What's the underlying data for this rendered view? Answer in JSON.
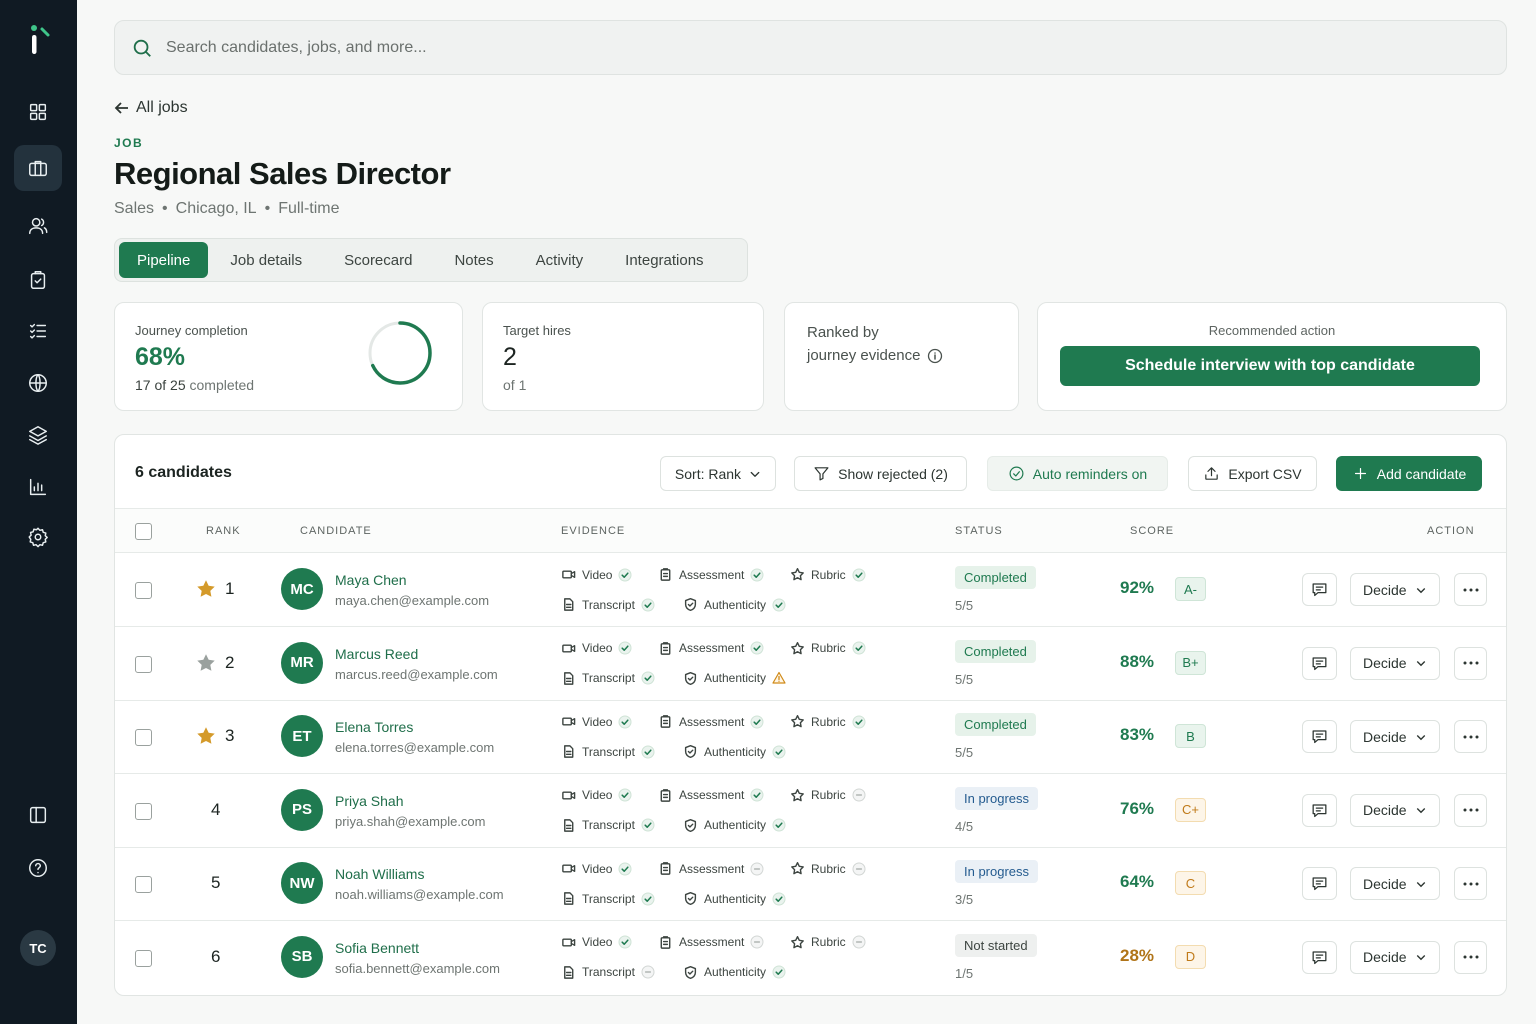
{
  "user": {
    "initials": "TC"
  },
  "search": {
    "placeholder": "Search candidates, jobs, and more..."
  },
  "nav": {
    "back_label": "All jobs",
    "items": [
      "grid-icon",
      "briefcase-icon",
      "users-icon",
      "clipboard-icon",
      "checklist-icon",
      "globe-icon",
      "layers-icon",
      "chart-icon",
      "gear-icon",
      "sidebar-toggle-icon",
      "help-icon"
    ],
    "active": "briefcase-icon"
  },
  "job": {
    "eyebrow": "JOB",
    "title": "Regional Sales Director",
    "department": "Sales",
    "location": "Chicago, IL",
    "type": "Full-time"
  },
  "tabs": [
    {
      "label": "Pipeline",
      "active": true
    },
    {
      "label": "Job details",
      "active": false
    },
    {
      "label": "Scorecard",
      "active": false
    },
    {
      "label": "Notes",
      "active": false
    },
    {
      "label": "Activity",
      "active": false
    },
    {
      "label": "Integrations",
      "active": false
    }
  ],
  "stats": {
    "completion": {
      "label": "Journey completion",
      "value": "68%",
      "fraction": 0.68,
      "done": "17 of 25",
      "suffix": "completed"
    },
    "hires": {
      "label": "Target hires",
      "value": "2",
      "sub": "of 1"
    },
    "ranked": {
      "line1": "Ranked by",
      "line2": "journey evidence"
    },
    "recommended": {
      "label": "Recommended action",
      "button": "Schedule interview with top candidate"
    }
  },
  "table": {
    "title": "6 candidates",
    "toolbar": {
      "sort": "Sort: Rank",
      "show_rejected": "Show rejected (2)",
      "reminders": "Auto reminders on",
      "export": "Export CSV",
      "add": "Add candidate"
    },
    "headers": {
      "rank": "RANK",
      "candidate": "CANDIDATE",
      "evidence": "EVIDENCE",
      "status": "STATUS",
      "score": "SCORE",
      "action": "ACTION"
    },
    "evidence_labels": {
      "video": "Video",
      "assessment": "Assessment",
      "rubric": "Rubric",
      "transcript": "Transcript",
      "authenticity": "Authenticity"
    },
    "decide_label": "Decide",
    "rows": [
      {
        "rank": "1",
        "star": "gold",
        "initials": "MC",
        "name": "Maya Chen",
        "email": "maya.chen@example.com",
        "ev": {
          "video": "done",
          "assessment": "done",
          "rubric": "done",
          "transcript": "done",
          "authenticity": "done"
        },
        "status": "Completed",
        "status_kind": "completed",
        "progress": "5/5",
        "score": "92%",
        "grade": "A-",
        "tone": "g"
      },
      {
        "rank": "2",
        "star": "silver",
        "initials": "MR",
        "name": "Marcus Reed",
        "email": "marcus.reed@example.com",
        "ev": {
          "video": "done",
          "assessment": "done",
          "rubric": "done",
          "transcript": "done",
          "authenticity": "warn"
        },
        "status": "Completed",
        "status_kind": "completed",
        "progress": "5/5",
        "score": "88%",
        "grade": "B+",
        "tone": "g"
      },
      {
        "rank": "3",
        "star": "gold",
        "initials": "ET",
        "name": "Elena Torres",
        "email": "elena.torres@example.com",
        "ev": {
          "video": "done",
          "assessment": "done",
          "rubric": "done",
          "transcript": "done",
          "authenticity": "done"
        },
        "status": "Completed",
        "status_kind": "completed",
        "progress": "5/5",
        "score": "83%",
        "grade": "B",
        "tone": "g"
      },
      {
        "rank": "4",
        "star": "none",
        "initials": "PS",
        "name": "Priya Shah",
        "email": "priya.shah@example.com",
        "ev": {
          "video": "done",
          "assessment": "done",
          "rubric": "pending",
          "transcript": "done",
          "authenticity": "done"
        },
        "status": "In progress",
        "status_kind": "progress",
        "progress": "4/5",
        "score": "76%",
        "grade": "C+",
        "tone": "o"
      },
      {
        "rank": "5",
        "star": "none",
        "initials": "NW",
        "name": "Noah Williams",
        "email": "noah.williams@example.com",
        "ev": {
          "video": "done",
          "assessment": "pending",
          "rubric": "pending",
          "transcript": "done",
          "authenticity": "done"
        },
        "status": "In progress",
        "status_kind": "progress",
        "progress": "3/5",
        "score": "64%",
        "grade": "C",
        "tone": "o"
      },
      {
        "rank": "6",
        "star": "none",
        "initials": "SB",
        "name": "Sofia Bennett",
        "email": "sofia.bennett@example.com",
        "ev": {
          "video": "done",
          "assessment": "pending",
          "rubric": "pending",
          "transcript": "pending",
          "authenticity": "done"
        },
        "status": "Not started",
        "status_kind": "notstarted",
        "progress": "1/5",
        "score": "28%",
        "grade": "D",
        "tone": "o"
      }
    ]
  },
  "colors": {
    "brand": "#1f7a50",
    "sidebar": "#101a23",
    "warn": "#d08a18",
    "gold": "#d49a2a",
    "silver": "#9aa19e",
    "score_low": "#b07418"
  }
}
